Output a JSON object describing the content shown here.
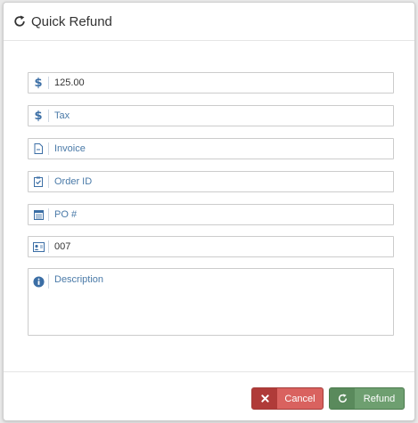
{
  "dialog": {
    "title": "Quick Refund",
    "title_icon": "refresh-icon"
  },
  "fields": {
    "amount": {
      "icon": "dollar-icon",
      "icon_glyph": "$",
      "value": "125.00",
      "placeholder": ""
    },
    "tax": {
      "icon": "dollar-icon",
      "icon_glyph": "$",
      "value": "",
      "placeholder": "Tax"
    },
    "invoice": {
      "icon": "document-icon",
      "value": "",
      "placeholder": "Invoice"
    },
    "order_id": {
      "icon": "clipboard-check-icon",
      "value": "",
      "placeholder": "Order ID"
    },
    "po": {
      "icon": "calendar-icon",
      "value": "",
      "placeholder": "PO #"
    },
    "customer_id": {
      "icon": "id-card-icon",
      "value": "007",
      "placeholder": ""
    },
    "description": {
      "icon": "info-circle-icon",
      "value": "",
      "placeholder": "Description"
    }
  },
  "buttons": {
    "cancel": {
      "label": "Cancel",
      "icon": "close-icon",
      "color": "#d9625f"
    },
    "refund": {
      "label": "Refund",
      "icon": "refresh-icon",
      "color": "#6e9f70"
    }
  }
}
